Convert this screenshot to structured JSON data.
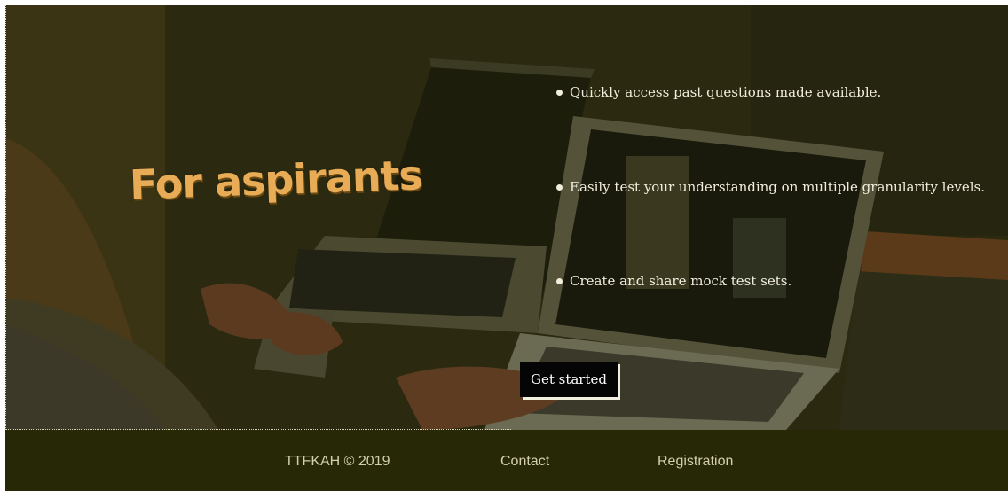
{
  "hero": {
    "headline": "For aspirants",
    "features": [
      "Quickly access past questions made available.",
      "Easily test your understanding on multiple granularity levels.",
      "Create and share mock test sets."
    ],
    "cta_label": "Get started"
  },
  "footer": {
    "copyright": "TTFKAH © 2019",
    "contact_label": "Contact",
    "registration_label": "Registration"
  },
  "colors": {
    "headline": "#e8ab56",
    "footer_bg": "#272906",
    "footer_text": "#d3cfad",
    "overlay": "#2b2a10"
  }
}
